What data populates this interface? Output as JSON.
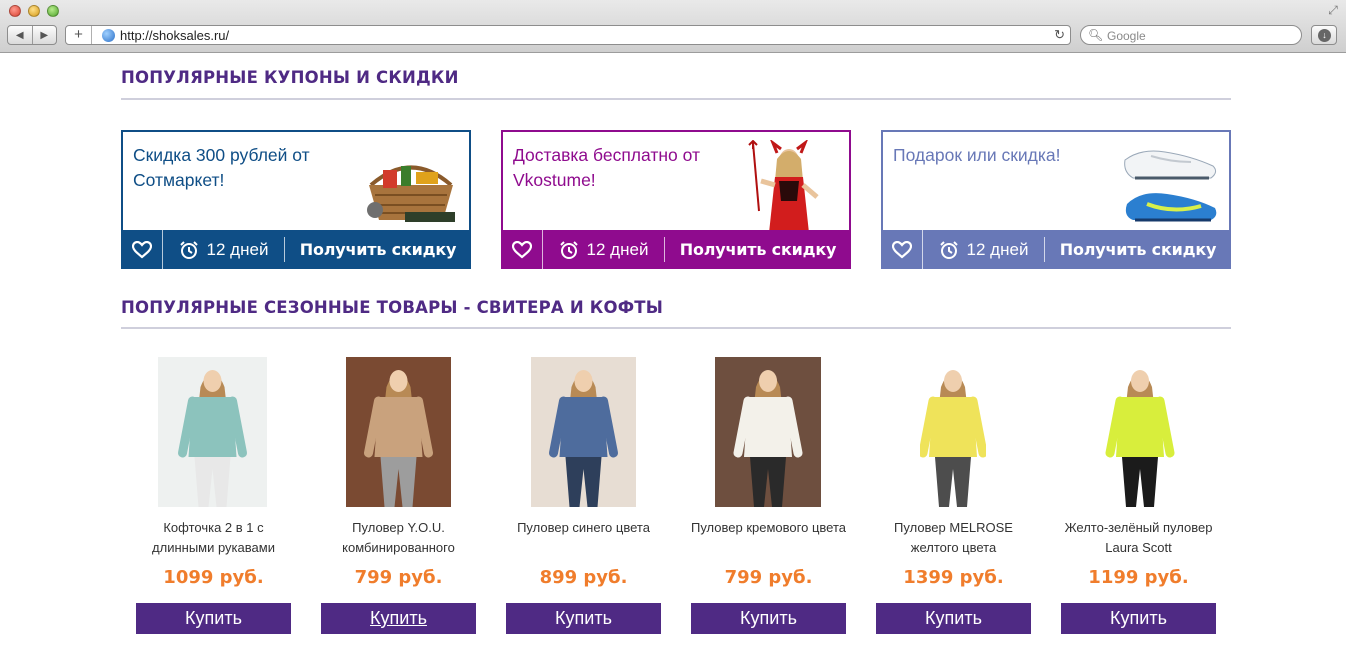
{
  "browser": {
    "url": "http://shoksales.ru/",
    "search_placeholder": "Google"
  },
  "coupons_section": {
    "title": "ПОПУЛЯРНЫЕ КУПОНЫ И СКИДКИ",
    "items": [
      {
        "text": "Скидка 300 рублей от Сотмаркет!",
        "days": "12 дней",
        "cta": "Получить скидку",
        "color": "#0f4e86",
        "image": "basket-with-tools-image"
      },
      {
        "text": "Доставка бесплатно от Vkostume!",
        "days": "12 дней",
        "cta": "Получить скидку",
        "color": "#8f0b8e",
        "image": "devil-costume-woman-image"
      },
      {
        "text": "Подарок или скидка!",
        "days": "12 дней",
        "cta": "Получить скидку",
        "color": "#6878b7",
        "image": "blue-football-boots-image"
      }
    ]
  },
  "products_section": {
    "title": "ПОПУЛЯРНЫЕ СЕЗОННЫЕ ТОВАРЫ - СВИТЕРА И КОФТЫ",
    "items": [
      {
        "name": "Кофточка 2 в 1 с длинными рукавами",
        "price": "1099 руб.",
        "buy": "Купить",
        "top_color": "#8cc3bd",
        "bottom_color": "#e8e8e8",
        "bg": "#eef1f0"
      },
      {
        "name": "Пуловер Y.O.U. комбинированного",
        "price": "799 руб.",
        "buy": "Купить",
        "top_color": "#c9a27d",
        "bottom_color": "#9d9d9d",
        "bg": "#7a4a32"
      },
      {
        "name": "Пуловер синего цвета",
        "price": "899 руб.",
        "buy": "Купить",
        "top_color": "#4e6c9d",
        "bottom_color": "#2e3f5b",
        "bg": "#e7ddd3"
      },
      {
        "name": "Пуловер кремового цвета",
        "price": "799 руб.",
        "buy": "Купить",
        "top_color": "#f3f1ea",
        "bottom_color": "#2a2a2a",
        "bg": "#6e4f3f"
      },
      {
        "name": "Пуловер MELROSE желтого цвета",
        "price": "1399 руб.",
        "buy": "Купить",
        "top_color": "#efe35a",
        "bottom_color": "#4d4d4d",
        "bg": "#ffffff"
      },
      {
        "name": "Желто-зелёный пуловер Laura Scott",
        "price": "1199 руб.",
        "buy": "Купить",
        "top_color": "#d8ee3c",
        "bottom_color": "#1b1b1b",
        "bg": "#ffffff"
      }
    ]
  }
}
